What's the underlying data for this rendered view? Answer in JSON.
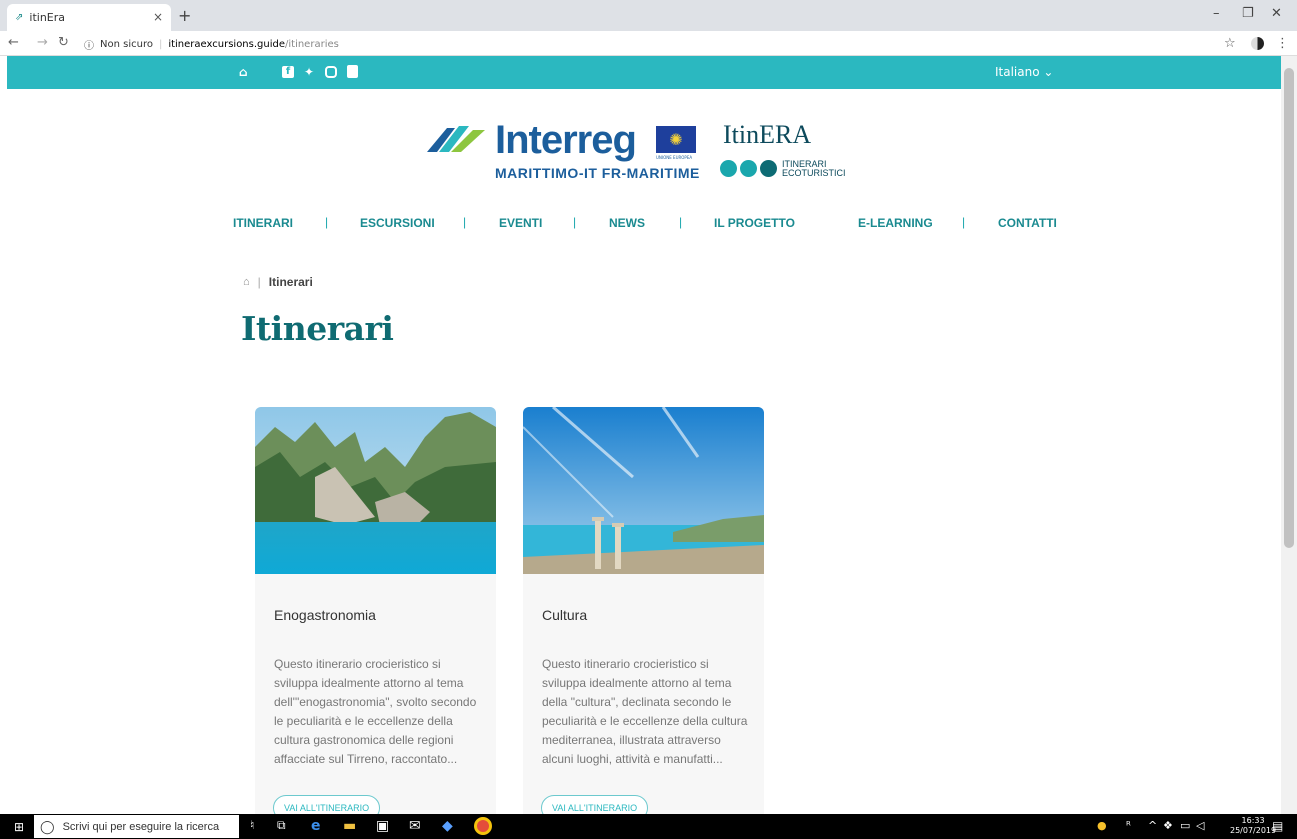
{
  "browser": {
    "tab_title": "itinEra",
    "tab_close": "×",
    "new_tab": "+",
    "security_label": "Non sicuro",
    "url_host": "itineraexcursions.guide",
    "url_path": "/itineraries",
    "window_controls": [
      "–",
      "❐",
      "✕"
    ]
  },
  "topbar": {
    "language": "Italiano ⌄",
    "social_icons": [
      "home-icon",
      "facebook-icon",
      "twitter-icon",
      "instagram-icon",
      "youtube-icon"
    ],
    "accent_color": "#2bb8c0"
  },
  "logos": {
    "interreg_word": "Interreg",
    "interreg_sub": "MARITTIMO-IT FR-MARITIME",
    "eu_label": "UNIONE EUROPEA",
    "itinera_word_a": "ItinERA",
    "itinera_sub_1": "ITINERARI",
    "itinera_sub_2": "ECOTURISTICI"
  },
  "nav": {
    "items": [
      "ITINERARI",
      "ESCURSIONI",
      "EVENTI",
      "NEWS",
      "IL PROGETTO",
      "E-LEARNING",
      "CONTATTI"
    ]
  },
  "breadcrumb": {
    "current": "Itinerari"
  },
  "page_title": "Itinerari",
  "cards": [
    {
      "title": "Enogastronomia",
      "description": "Questo itinerario crocieristico si sviluppa idealmente attorno al tema dell'\"enogastronomia\", svolto secondo le peculiarità e le eccellenze della cultura gastronomica delle regioni affacciate sul Tirreno, raccontato...",
      "button": "VAI ALL'ITINERARIO"
    },
    {
      "title": "Cultura",
      "description": "Questo itinerario crocieristico si sviluppa idealmente attorno al tema della \"cultura\", declinata secondo le peculiarità e le eccellenze della cultura mediterranea, illustrata attraverso alcuni luoghi, attività e manufatti...",
      "button": "VAI ALL'ITINERARIO"
    }
  ],
  "taskbar": {
    "search_placeholder": "Scrivi qui per eseguire la ricerca",
    "time": "16:33",
    "date": "25/07/2019"
  }
}
